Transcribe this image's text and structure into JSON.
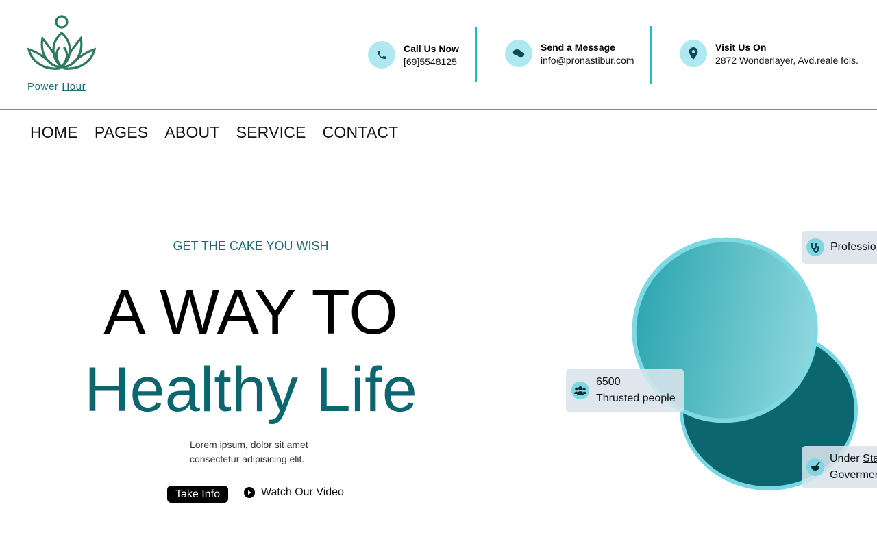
{
  "brand": {
    "name_part1": "Power",
    "name_part2": "Hour",
    "logo_icon": "lotus-icon",
    "color": "#1d6b73"
  },
  "contacts": [
    {
      "icon": "phone-icon",
      "title": "Call Us Now",
      "value": "[69]5548125"
    },
    {
      "icon": "chat-icon",
      "title": "Send a Message",
      "value": "info@pronastibur.com"
    },
    {
      "icon": "location-icon",
      "title": "Visit Us On",
      "value": "2872 Wonderlayer, Avd.reale fois."
    }
  ],
  "nav": [
    "HOME",
    "PAGES",
    "ABOUT",
    "SERVICE",
    "CONTACT"
  ],
  "hero": {
    "tagline": "GET THE CAKE YOU WISH",
    "title_line1": "A WAY TO",
    "title_line2": "Healthy Life",
    "description": "Lorem ipsum, dolor sit amet consectetur adipisicing elit.",
    "primary_button": "Take Info",
    "video_button": "Watch Our Video"
  },
  "badges": {
    "professional": {
      "icon": "stethoscope-icon",
      "label": "Professio"
    },
    "people": {
      "icon": "users-icon",
      "count": "6500",
      "label": "Thrusted people"
    },
    "government": {
      "icon": "mortar-pestle-icon",
      "line1_a": "Under",
      "line1_b": "Sta",
      "line2": "Govermer"
    }
  },
  "colors": {
    "accent": "#2bb3c8",
    "dark_teal": "#0b6670",
    "light_teal": "#aee8f0"
  }
}
